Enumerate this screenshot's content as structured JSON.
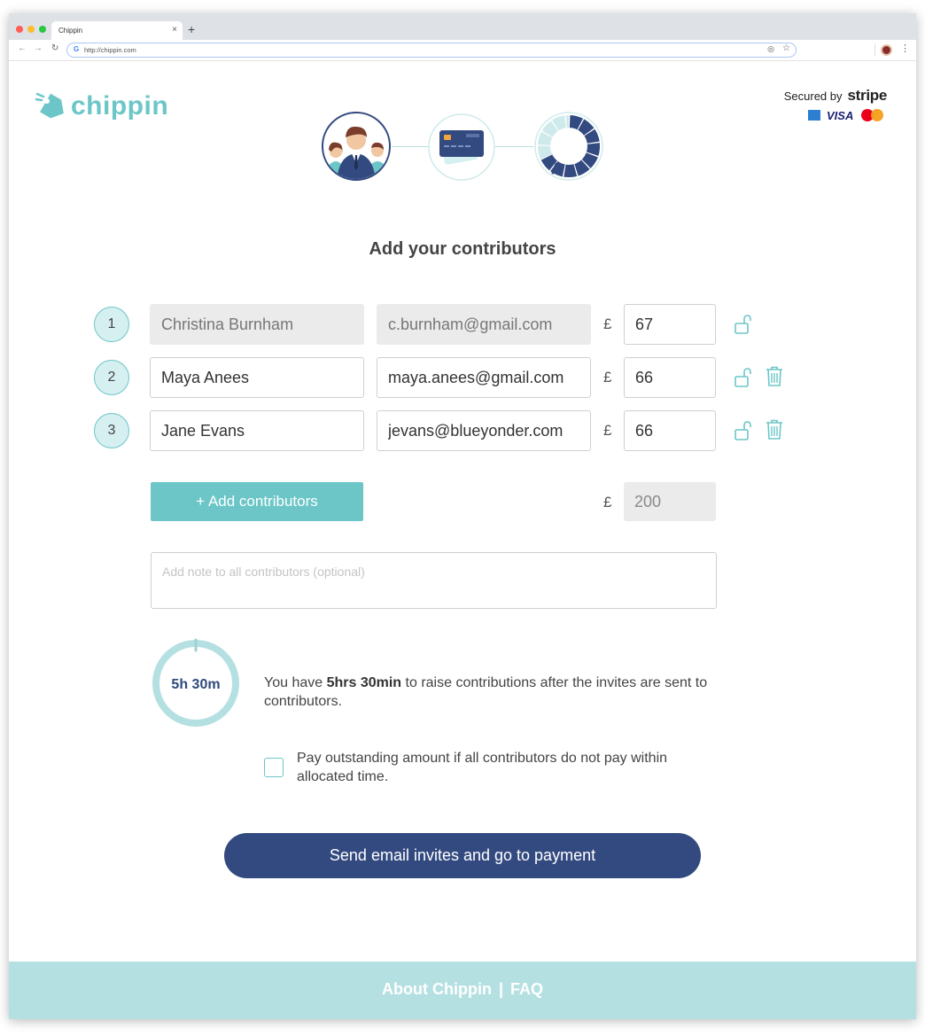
{
  "browser": {
    "tab_title": "Chippin",
    "tab_close": "×",
    "new_tab": "+",
    "url": "http://chippin.com"
  },
  "brand": {
    "name": "chippin",
    "color": "#6cc6c8",
    "navy": "#334a80"
  },
  "secured": {
    "label": "Secured by",
    "provider": "stripe",
    "cards": [
      "amex-icon",
      "visa-icon",
      "mastercard-icon"
    ],
    "visa_text": "VISA"
  },
  "steps": [
    {
      "icon": "contributors-icon",
      "active": true
    },
    {
      "icon": "credit-card-icon",
      "active": false
    },
    {
      "icon": "progress-donut-icon",
      "active": false
    }
  ],
  "heading": "Add your contributors",
  "currency": "£",
  "contributors": [
    {
      "index": "1",
      "name": "Christina Burnham",
      "email": "c.burnham@gmail.com",
      "amount": "67",
      "locked": true,
      "deletable": false
    },
    {
      "index": "2",
      "name": "Maya Anees",
      "email": "maya.anees@gmail.com",
      "amount": "66",
      "locked": false,
      "deletable": true
    },
    {
      "index": "3",
      "name": "Jane Evans",
      "email": "jevans@blueyonder.com",
      "amount": "66",
      "locked": false,
      "deletable": true
    }
  ],
  "add_button": "+ Add contributors",
  "total": "200",
  "note_placeholder": "Add note to all contributors (optional)",
  "timer": {
    "label": "5h 30m",
    "elapsed_fraction": 0.02
  },
  "info": {
    "prefix": "You have ",
    "bold": "5hrs 30min",
    "suffix": " to raise contributions after the invites are sent to contributors."
  },
  "checkbox": {
    "label": "Pay outstanding amount if all contributors do not pay within allocated time.",
    "checked": false
  },
  "send_button": "Send email invites and go to payment",
  "footer": {
    "about": "About Chippin",
    "separator": "|",
    "faq": "FAQ"
  }
}
